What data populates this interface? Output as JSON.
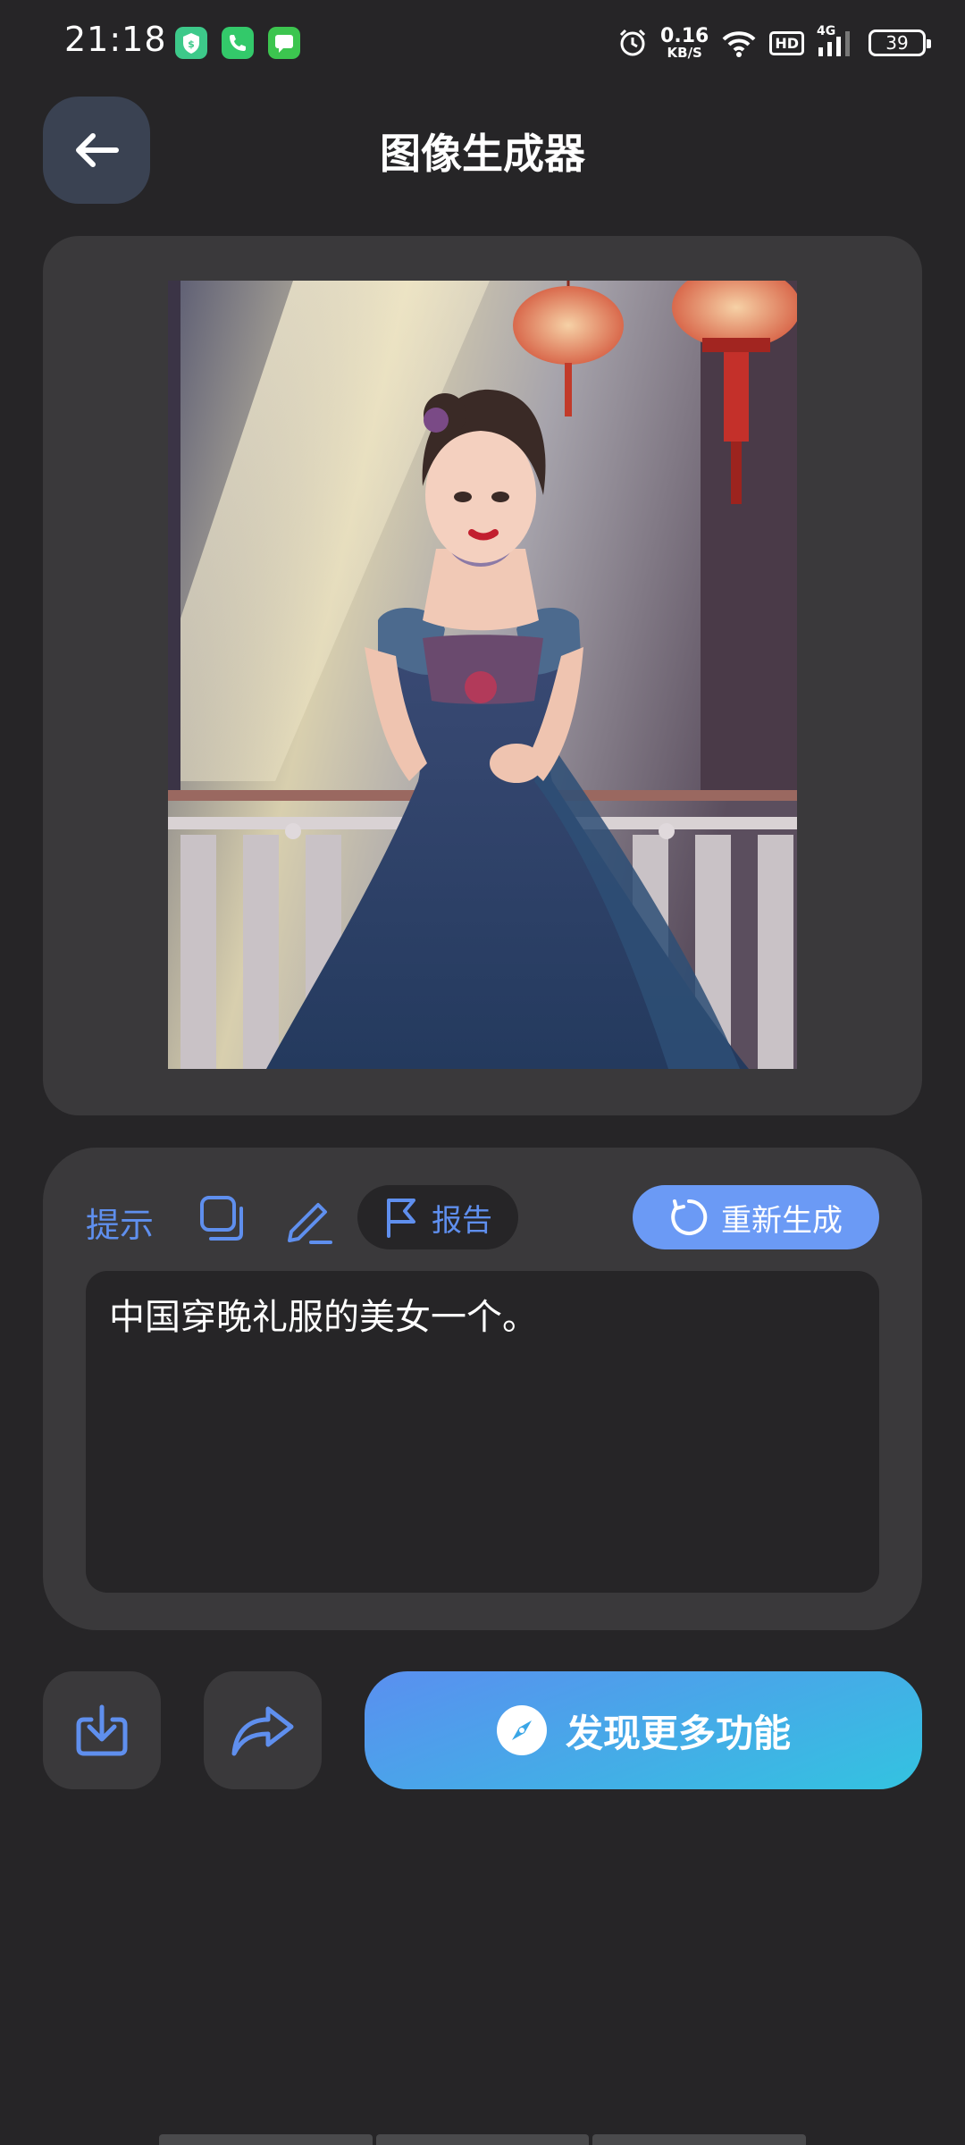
{
  "status_bar": {
    "time": "21:18",
    "net_speed_value": "0.16",
    "net_speed_unit": "KB/S",
    "hd_label": "HD",
    "network_label": "4G",
    "battery_level": "39",
    "notification_icons": [
      "shield-app-icon",
      "phone-app-icon",
      "messages-app-icon"
    ]
  },
  "header": {
    "title": "图像生成器"
  },
  "prompt_panel": {
    "label": "提示",
    "report_label": "报告",
    "regenerate_label": "重新生成",
    "prompt_text": "中国穿晚礼服的美女一个。"
  },
  "actions": {
    "discover_label": "发现更多功能"
  },
  "colors": {
    "background": "#262527",
    "card": "#3a393b",
    "accent_blue": "#5f8fee",
    "regen_button": "#6b9af5",
    "discover_gradient_start": "#5a8ff0",
    "discover_gradient_end": "#33c3e0"
  }
}
